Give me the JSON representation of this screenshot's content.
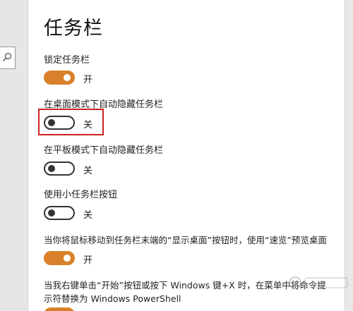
{
  "page": {
    "title": "任务栏",
    "accent_color": "#d9812a"
  },
  "search": {
    "icon": "search-icon"
  },
  "settings": [
    {
      "label": "锁定任务栏",
      "state": "开",
      "on": true
    },
    {
      "label": "在桌面模式下自动隐藏任务栏",
      "state": "关",
      "on": false,
      "highlighted": true
    },
    {
      "label": "在平板模式下自动隐藏任务栏",
      "state": "关",
      "on": false
    },
    {
      "label": "使用小任务栏按钮",
      "state": "关",
      "on": false
    },
    {
      "label": "当你将鼠标移动到任务栏末端的“显示桌面”按钮时，使用“速览”预览桌面",
      "state": "开",
      "on": true
    },
    {
      "label_line1": "当我右键单击“开始”按钮或按下 Windows 键+X 时，在菜单中将命令提",
      "label_line2": "示符替换为 Windows PowerShell",
      "on": true
    }
  ],
  "watermark": {
    "icon": "baidu-jingyan-logo"
  }
}
